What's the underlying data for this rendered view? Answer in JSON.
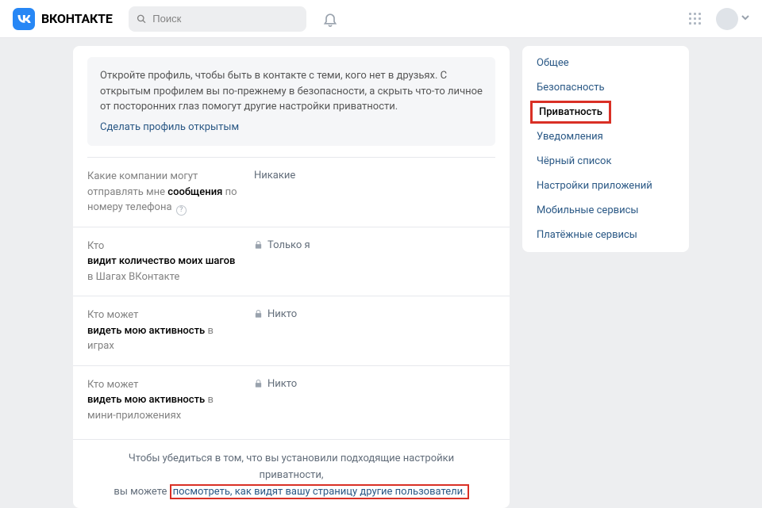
{
  "header": {
    "brand": "ВКОНТАКТЕ",
    "search_placeholder": "Поиск"
  },
  "sidebar": {
    "items": [
      {
        "label": "Общее"
      },
      {
        "label": "Безопасность"
      },
      {
        "label": "Приватность",
        "active": true
      },
      {
        "label": "Уведомления"
      },
      {
        "label": "Чёрный список"
      },
      {
        "label": "Настройки приложений"
      },
      {
        "label": "Мобильные сервисы"
      },
      {
        "label": "Платёжные сервисы"
      }
    ]
  },
  "infobox": {
    "text": "Откройте профиль, чтобы быть в контакте с теми, кого нет в друзьях. С открытым профилем вы по-прежнему в безопасности, а скрыть что-то личное от посторонних глаз помогут другие настройки приватности.",
    "action": "Сделать профиль открытым"
  },
  "settings": [
    {
      "label_pre": "Какие компании могут отправлять мне ",
      "label_bold": "сообщения",
      "label_post": " по номеру телефона ",
      "help": true,
      "value": "Никакие",
      "lock": false
    },
    {
      "label_pre": "Кто\n",
      "label_bold": "видит количество моих шагов",
      "label_post": " в Шагах ВКонтакте",
      "value": "Только я",
      "lock": true
    },
    {
      "label_pre": "Кто может\n",
      "label_bold": "видеть мою активность",
      "label_post": " в играх",
      "value": "Никто",
      "lock": true
    },
    {
      "label_pre": "Кто может\n",
      "label_bold": "видеть мою активность",
      "label_post": " в мини-приложениях",
      "value": "Никто",
      "lock": true
    }
  ],
  "footer": {
    "line1": "Чтобы убедиться в том, что вы установили подходящие настройки приватности,",
    "line2_pre": "вы можете ",
    "line2_link": "посмотреть, как видят вашу страницу другие пользователи."
  }
}
